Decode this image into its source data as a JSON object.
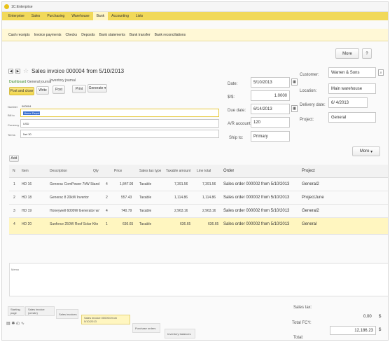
{
  "window": {
    "title": "1C:Enterprise"
  },
  "menubar": {
    "items": [
      "Enterprise",
      "Sales",
      "Purchasing",
      "Warehouse",
      "Bank",
      "Accounting",
      "Lists"
    ]
  },
  "submenu": {
    "items": [
      "Bank",
      "Accounting",
      "Lists"
    ]
  },
  "nav": {
    "items": [
      "Cash receipts",
      "Invoice payments",
      "Checks",
      "Deposits",
      "Bank statements",
      "Bank transfer",
      "Bank reconciliations"
    ]
  },
  "top_buttons": {
    "more": "More",
    "help": "?"
  },
  "doc": {
    "title": "Sales invoice 000004 from 5/10/2013",
    "links": [
      "Dashboard",
      "General journal",
      "Inventory journal"
    ],
    "post_close": "Post and close",
    "buttons": [
      "Write",
      "Post",
      "Print",
      "Generate"
    ],
    "fields_left": {
      "number_label": "Number",
      "number": "000004",
      "bill_label": "Bill to",
      "bill": "Home Depot",
      "currency_label": "Currency",
      "currency": "USD",
      "terms_label": "Terms",
      "terms": "Net 30"
    },
    "fields_mid": {
      "date_label": "Date:",
      "date": "5/10/2013",
      "rate_label": "$/$:",
      "rate": "1.0000",
      "due_label": "Due date:",
      "due": "6/14/2013",
      "ar_label": "A/R account:",
      "ar": "120",
      "ship_label": "Ship to:",
      "ship": "Primary"
    },
    "fields_right": {
      "customer_label": "Customer:",
      "customer": "Warren & Sons",
      "location_label": "Location:",
      "location": "Main warehouse",
      "delivery_label": "Delivery date:",
      "delivery": "6/ 4/2013",
      "project_label": "Project:",
      "project": "General"
    }
  },
  "lines": {
    "add": "Add",
    "more": "More",
    "columns": [
      "N",
      "Item",
      "Description",
      "Qty",
      "Price",
      "Sales tax type",
      "Taxable amount",
      "Line total",
      "Order",
      "Project"
    ],
    "rows": [
      {
        "n": "1",
        "item": "HD 16",
        "desc": "Generac ComPower 7kW Stand",
        "qty": "4",
        "price": "1,847.99",
        "tax": "Taxable",
        "taxable": "7,391.56",
        "total": "7,391.56",
        "order": "Sales order 000002 from 5/10/2013",
        "project": "General2"
      },
      {
        "n": "2",
        "item": "HD 18",
        "desc": "Generac 8 20kW Invertor",
        "qty": "2",
        "price": "557.43",
        "tax": "Taxable",
        "taxable": "1,114.86",
        "total": "1,114.86",
        "order": "Sales order 000002 from 5/10/2013",
        "project": "ProjectJune"
      },
      {
        "n": "3",
        "item": "HD 19",
        "desc": "Honeywell 6000W Generator w/",
        "qty": "4",
        "price": "740.79",
        "tax": "Taxable",
        "taxable": "2,963.16",
        "total": "2,963.16",
        "order": "Sales order 000002 from 5/10/2013",
        "project": "General2"
      },
      {
        "n": "4",
        "item": "HD 20",
        "desc": "Sunforce 250W Roof Solar Kite",
        "qty": "1",
        "price": "636.65",
        "tax": "Taxable",
        "taxable": "636.65",
        "total": "636.65",
        "order": "Sales order 000002 from 5/10/2013",
        "project": "General"
      }
    ]
  },
  "memo_label": "Memo",
  "totals": {
    "sales_tax_label": "Sales tax:",
    "sales_tax": "0.00",
    "fcy_label": "Total FCY:",
    "fcy": "12,186.23",
    "total_label": "Total:",
    "currency": "$"
  },
  "taskbar": {
    "tabs": [
      "Starting page",
      "Sales invoice (create)",
      "Sales invoices",
      "Sales invoice 000004 from 5/10/2013",
      "Purchase orders",
      "Inventory balances"
    ]
  },
  "colors": {
    "accent": "#f1d95a",
    "highlight": "#fff6c0"
  }
}
